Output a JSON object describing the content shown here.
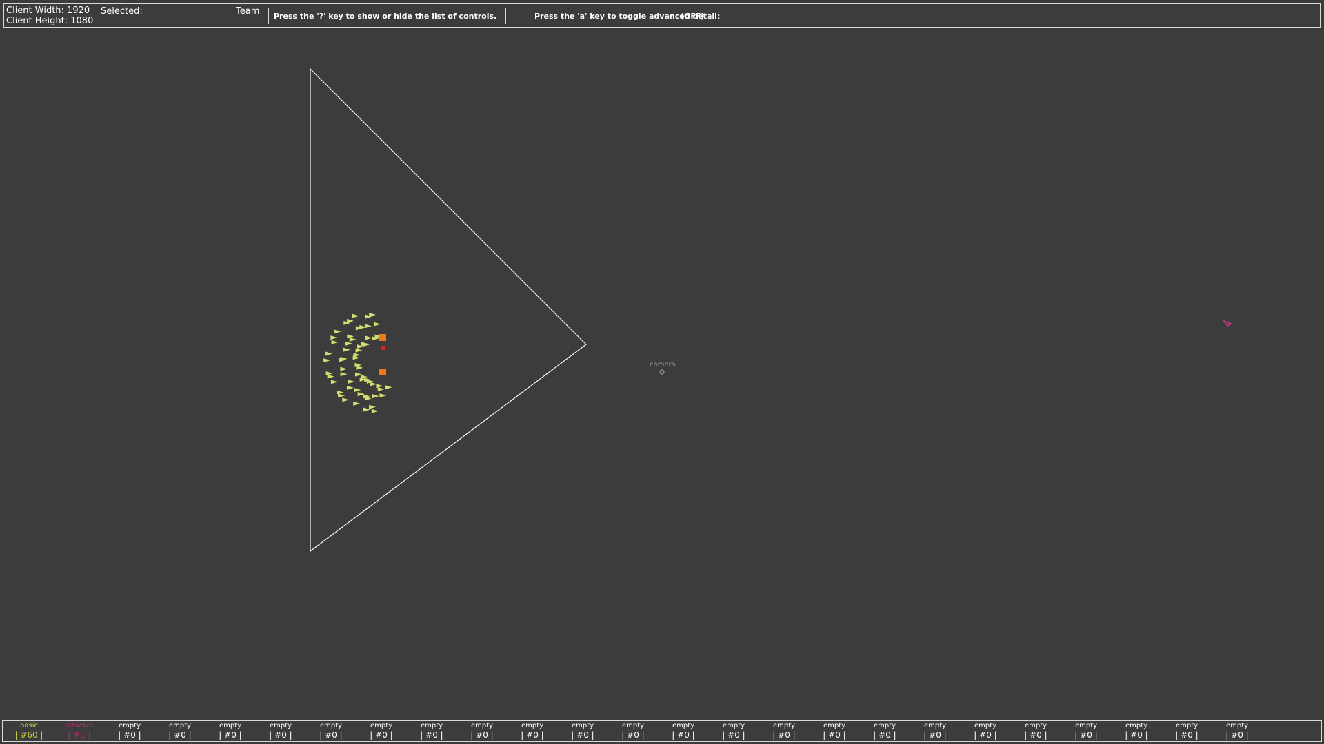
{
  "hud": {
    "client_width_label": "Client Width: 1920",
    "client_height_label": "Client Height: 1080",
    "selected_label": "Selected:",
    "team_label": "Team",
    "controls_hint": "Press the '?' key to show or hide the list of controls.",
    "advanced_hint": "Press the 'a' key to toggle advanced detail:",
    "advanced_state": "(OFF)"
  },
  "scene": {
    "camera_label": "camera",
    "colors": {
      "background": "#3c3c3c",
      "triangle": "#ffffff",
      "basic_unit": "#d4dc6e",
      "attacker_unit": "#d8348a",
      "orange_marker": "#f07818",
      "red_marker": "#e02020"
    }
  },
  "squads": [
    {
      "name": "basic",
      "count": "| #60 |",
      "color": "#c8d040"
    },
    {
      "name": "attacker",
      "count": "| #1 |",
      "color": "#c02070"
    },
    {
      "name": "empty",
      "count": "| #0 |",
      "color": "#ffffff"
    },
    {
      "name": "empty",
      "count": "| #0 |",
      "color": "#ffffff"
    },
    {
      "name": "empty",
      "count": "| #0 |",
      "color": "#ffffff"
    },
    {
      "name": "empty",
      "count": "| #0 |",
      "color": "#ffffff"
    },
    {
      "name": "empty",
      "count": "| #0 |",
      "color": "#ffffff"
    },
    {
      "name": "empty",
      "count": "| #0 |",
      "color": "#ffffff"
    },
    {
      "name": "empty",
      "count": "| #0 |",
      "color": "#ffffff"
    },
    {
      "name": "empty",
      "count": "| #0 |",
      "color": "#ffffff"
    },
    {
      "name": "empty",
      "count": "| #0 |",
      "color": "#ffffff"
    },
    {
      "name": "empty",
      "count": "| #0 |",
      "color": "#ffffff"
    },
    {
      "name": "empty",
      "count": "| #0 |",
      "color": "#ffffff"
    },
    {
      "name": "empty",
      "count": "| #0 |",
      "color": "#ffffff"
    },
    {
      "name": "empty",
      "count": "| #0 |",
      "color": "#ffffff"
    },
    {
      "name": "empty",
      "count": "| #0 |",
      "color": "#ffffff"
    },
    {
      "name": "empty",
      "count": "| #0 |",
      "color": "#ffffff"
    },
    {
      "name": "empty",
      "count": "| #0 |",
      "color": "#ffffff"
    },
    {
      "name": "empty",
      "count": "| #0 |",
      "color": "#ffffff"
    },
    {
      "name": "empty",
      "count": "| #0 |",
      "color": "#ffffff"
    },
    {
      "name": "empty",
      "count": "| #0 |",
      "color": "#ffffff"
    },
    {
      "name": "empty",
      "count": "| #0 |",
      "color": "#ffffff"
    },
    {
      "name": "empty",
      "count": "| #0 |",
      "color": "#ffffff"
    },
    {
      "name": "empty",
      "count": "| #0 |",
      "color": "#ffffff"
    },
    {
      "name": "empty",
      "count": "| #0 |",
      "color": "#ffffff"
    }
  ]
}
